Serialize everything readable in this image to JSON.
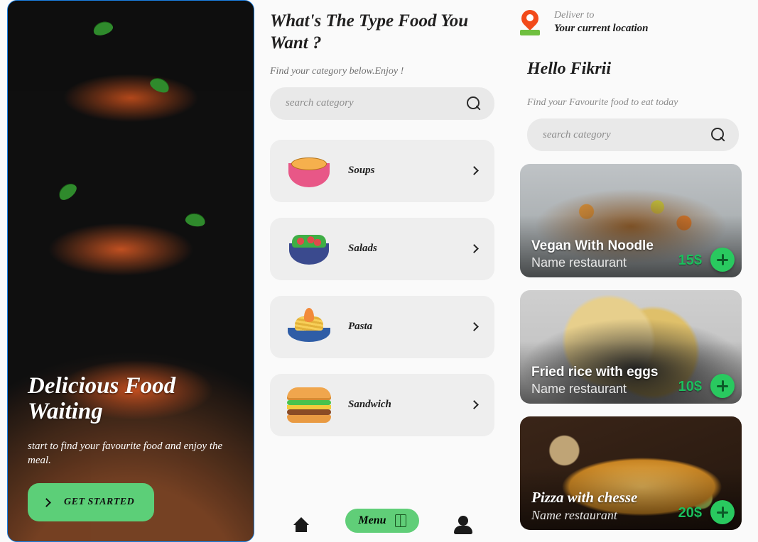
{
  "hero": {
    "title_line1": "Delicious Food",
    "title_line2": "Waiting",
    "subtitle": "start to find your favourite food and enjoy the meal.",
    "cta": "GET STARTED"
  },
  "categories": {
    "title": "What's The Type Food You Want ?",
    "subtitle": "Find your category below.Enjoy !",
    "search_placeholder": "search category",
    "items": [
      {
        "label": "Soups",
        "icon": "soup-icon"
      },
      {
        "label": "Salads",
        "icon": "salad-icon"
      },
      {
        "label": "Pasta",
        "icon": "pasta-icon"
      },
      {
        "label": "Sandwich",
        "icon": "sandwich-icon"
      }
    ],
    "nav": {
      "home": "Home",
      "menu": "Menu",
      "profile": "Profile"
    }
  },
  "feed": {
    "deliver_label": "Deliver to",
    "deliver_value": "Your current location",
    "greeting": "Hello Fikrii",
    "subtitle": "Find your Favourite food to eat today",
    "search_placeholder": "search category",
    "cards": [
      {
        "title": "Vegan With Noodle",
        "restaurant": "Name restaurant",
        "price": "15$"
      },
      {
        "title": "Fried rice with eggs",
        "restaurant": "Name restaurant",
        "price": "10$"
      },
      {
        "title": "Pizza with chesse",
        "restaurant": "Name restaurant",
        "price": "20$"
      }
    ]
  }
}
